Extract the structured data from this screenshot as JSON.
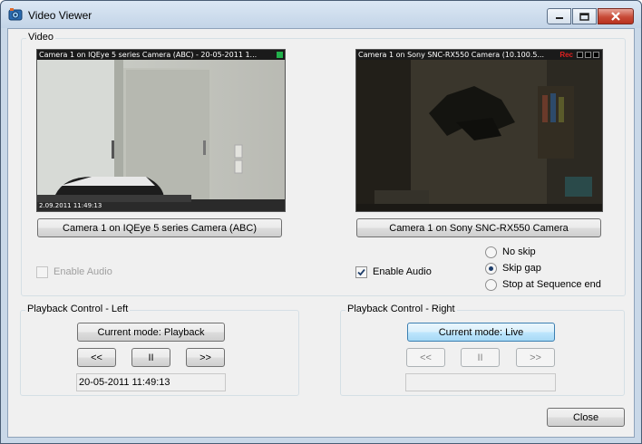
{
  "window": {
    "title": "Video Viewer",
    "caption_buttons": {
      "minimize": "minimize-icon",
      "maximize": "maximize-icon",
      "close": "close-icon"
    }
  },
  "video_group": {
    "label": "Video",
    "left": {
      "caption": "Camera 1 on IQEye 5 series Camera (ABC) - 20-05-2011 1...",
      "overlay_text": "2.09.2011 11:49:13",
      "button": "Camera 1 on IQEye 5 series Camera (ABC)",
      "enable_audio": {
        "label": "Enable Audio",
        "checked": false,
        "enabled": false
      }
    },
    "right": {
      "caption": "Camera 1 on Sony SNC-RX550 Camera (10.100.5...",
      "rec_label": "Rec",
      "button": "Camera 1 on Sony SNC-RX550 Camera",
      "enable_audio": {
        "label": "Enable Audio",
        "checked": true,
        "enabled": true
      }
    },
    "skip_options": [
      {
        "label": "No skip",
        "selected": false
      },
      {
        "label": "Skip gap",
        "selected": true
      },
      {
        "label": "Stop at Sequence end",
        "selected": false
      }
    ]
  },
  "playback_left": {
    "label": "Playback Control - Left",
    "mode_button": "Current mode: Playback",
    "rewind": "<<",
    "pause": "II",
    "forward": ">>",
    "timestamp": "20-05-2011  11:49:13"
  },
  "playback_right": {
    "label": "Playback Control - Right",
    "mode_button": "Current mode: Live",
    "rewind": "<<",
    "pause": "II",
    "forward": ">>",
    "timestamp": ""
  },
  "footer": {
    "close_button": "Close"
  },
  "colors": {
    "title_bg": "#c9d8e8",
    "close_red": "#c84a37",
    "live_green": "#22b14c",
    "rec_red": "#e02020"
  }
}
